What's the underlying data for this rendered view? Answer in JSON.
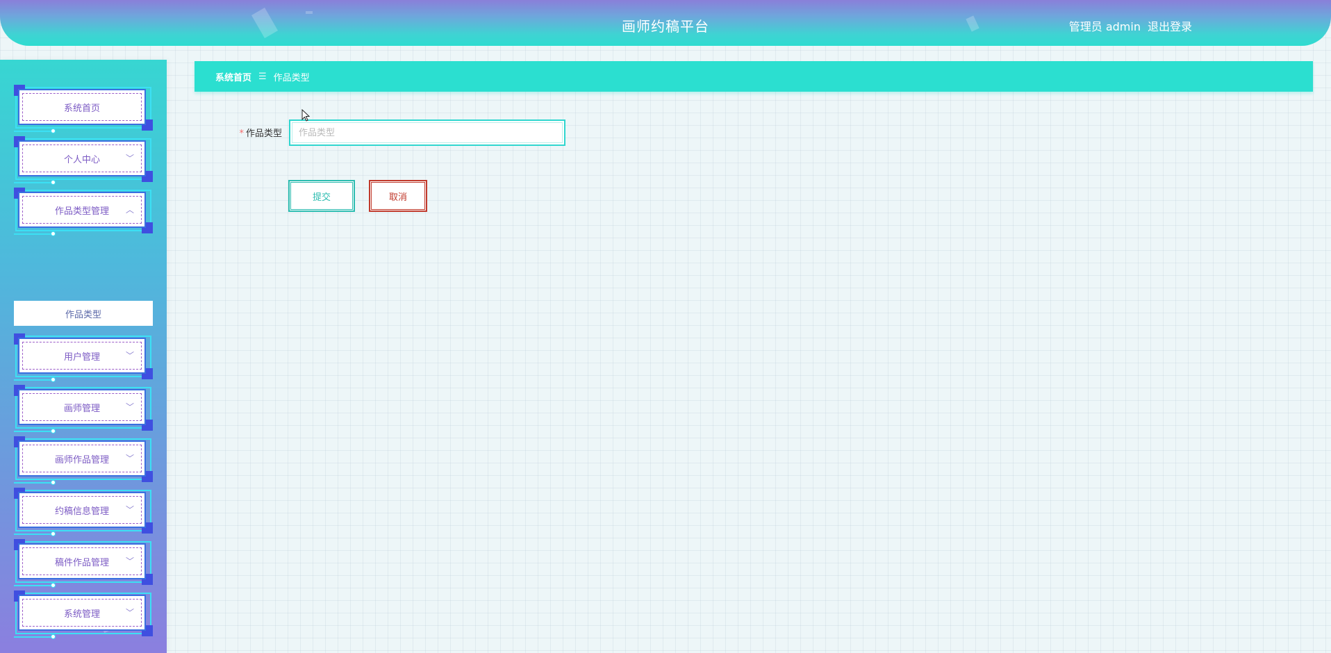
{
  "header": {
    "title": "画师约稿平台",
    "role_user": "管理员 admin",
    "logout": "退出登录"
  },
  "sidebar": {
    "items": [
      {
        "label": "系统首页",
        "icon": "none"
      },
      {
        "label": "个人中心",
        "icon": "chevron-down-icon"
      },
      {
        "label": "作品类型管理",
        "icon": "chevron-up-icon"
      },
      {
        "label": "用户管理",
        "icon": "chevron-down-icon"
      },
      {
        "label": "画师管理",
        "icon": "chevron-down-icon"
      },
      {
        "label": "画师作品管理",
        "icon": "chevron-down-icon"
      },
      {
        "label": "约稿信息管理",
        "icon": "chevron-down-icon"
      },
      {
        "label": "稿件作品管理",
        "icon": "chevron-down-icon"
      },
      {
        "label": "系统管理",
        "icon": "chevron-down-icon"
      }
    ],
    "subitem": "作品类型",
    "chevron_down": "﹀",
    "chevron_up": "︿"
  },
  "breadcrumb": {
    "home": "系统首页",
    "separator": "☰",
    "current": "作品类型"
  },
  "form": {
    "required_mark": "*",
    "label": "作品类型",
    "placeholder": "作品类型",
    "value": "",
    "submit": "提交",
    "cancel": "取消"
  },
  "colors": {
    "accent": "#2bdfd0",
    "submit": "#2cbcb0",
    "cancel": "#c0392b"
  }
}
